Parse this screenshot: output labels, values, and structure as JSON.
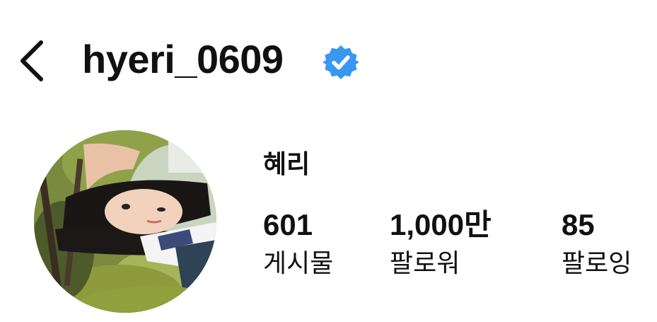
{
  "header": {
    "username": "hyeri_0609",
    "back_icon": "chevron-left-icon",
    "verified_icon": "verified-badge-icon",
    "verified_color": "#3897f0"
  },
  "profile": {
    "display_name": "혜리",
    "avatar": "profile-photo"
  },
  "stats": {
    "posts": {
      "value": "601",
      "label": "게시물"
    },
    "followers": {
      "value": "1,000만",
      "label": "팔로워"
    },
    "following": {
      "value": "85",
      "label": "팔로잉"
    }
  }
}
